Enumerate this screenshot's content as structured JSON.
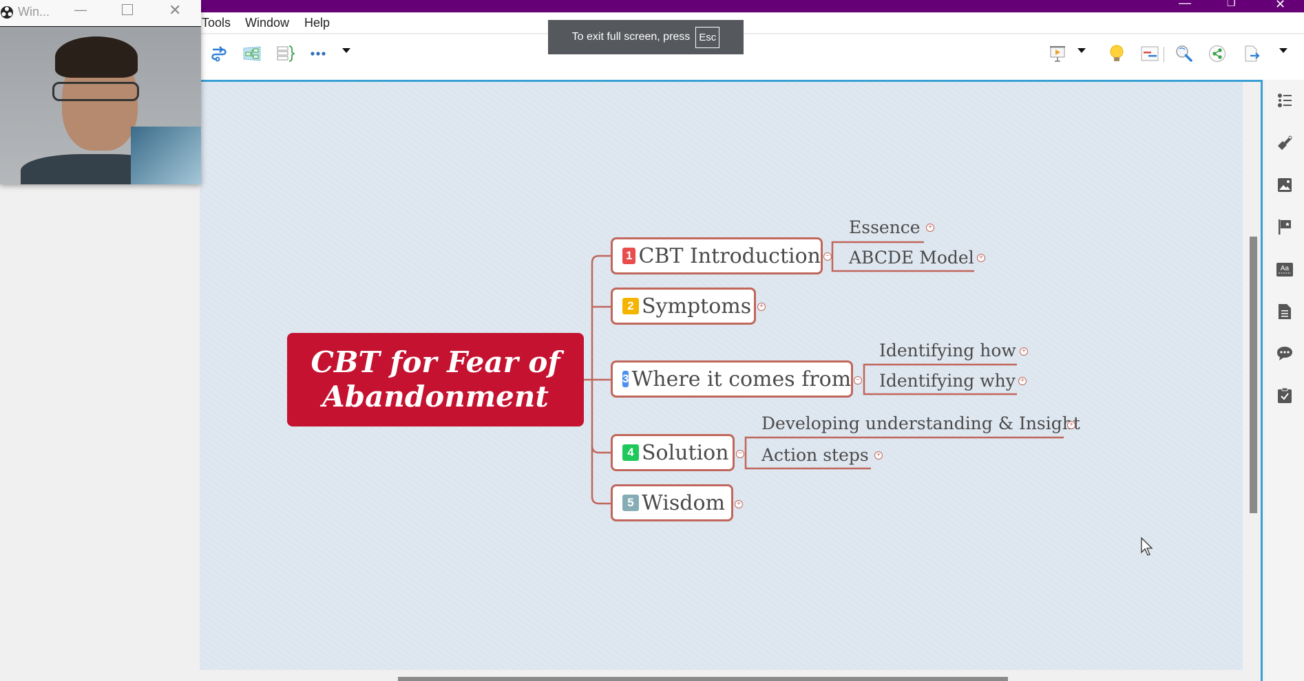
{
  "app": {
    "title_bar_color": "#660077",
    "window_controls": [
      "minimize",
      "restore",
      "close"
    ]
  },
  "menu": {
    "items": [
      "Tools",
      "Window",
      "Help"
    ]
  },
  "toolbar": {
    "left_tools": [
      "relationship-icon",
      "structure-icon",
      "summary-icon",
      "more-icon"
    ],
    "right_tools": [
      "presentation-icon",
      "brainstorm-icon",
      "gantt-icon",
      "search-icon",
      "share-icon",
      "export-icon"
    ]
  },
  "fullscreen_notice": {
    "text": "To exit full screen, press",
    "key": "Esc"
  },
  "webcam_window": {
    "title": "Win..."
  },
  "sidebar": {
    "icons": [
      "outline-icon",
      "format-brush-icon",
      "image-icon",
      "marker-flag-icon",
      "text-style-icon",
      "notes-icon",
      "comment-icon",
      "task-icon"
    ]
  },
  "mindmap": {
    "central_topic": {
      "line1": "CBT for Fear of",
      "line2": "Abandonment",
      "color": "#c41230"
    },
    "branch_color": "#c0665a",
    "topics": [
      {
        "number": "1",
        "label": "CBT Introduction",
        "badge_color": "#e84c4c",
        "subtopics": [
          "Essence",
          "ABCDE Model"
        ]
      },
      {
        "number": "2",
        "label": "Symptoms",
        "badge_color": "#f5b400",
        "subtopics": []
      },
      {
        "number": "3",
        "label": "Where it comes from",
        "badge_color": "#4f8ff0",
        "subtopics": [
          "Identifying how",
          "Identifying why"
        ]
      },
      {
        "number": "4",
        "label": "Solution",
        "badge_color": "#1ec85a",
        "subtopics": [
          "Developing understanding & Insight",
          "Action steps"
        ]
      },
      {
        "number": "5",
        "label": "Wisdom",
        "badge_color": "#86adb5",
        "subtopics": []
      }
    ]
  }
}
